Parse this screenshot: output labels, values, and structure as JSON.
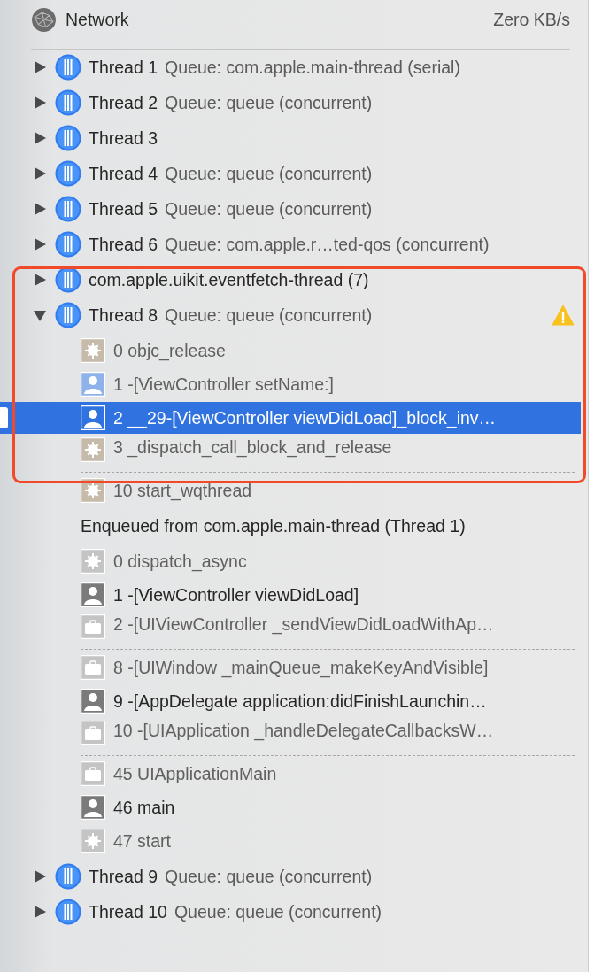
{
  "header": {
    "title": "Network",
    "rate": "Zero KB/s"
  },
  "annotation_box": true,
  "threads": [
    {
      "name": "Thread 1",
      "queue": "Queue: com.apple.main-thread (serial)",
      "expanded": false
    },
    {
      "name": "Thread 2",
      "queue": "Queue: queue (concurrent)",
      "expanded": false
    },
    {
      "name": "Thread 3",
      "expanded": false
    },
    {
      "name": "Thread 4",
      "queue": "Queue: queue (concurrent)",
      "expanded": false
    },
    {
      "name": "Thread 5",
      "queue": "Queue: queue (concurrent)",
      "expanded": false
    },
    {
      "name": "Thread 6",
      "queue": "Queue: com.apple.r…ted-qos (concurrent)",
      "expanded": false
    },
    {
      "name": "com.apple.uikit.eventfetch-thread (7)",
      "expanded": false
    },
    {
      "name": "Thread 8",
      "queue": "Queue: queue (concurrent)",
      "expanded": true,
      "warning": true,
      "frames": [
        {
          "label": "0 objc_release",
          "kind": "system",
          "selected": false,
          "break_after": false
        },
        {
          "label": "1 -[ViewController setName:]",
          "kind": "user",
          "selected": false,
          "break_after": false
        },
        {
          "label": "2 __29-[ViewController viewDidLoad]_block_inv…",
          "kind": "user",
          "selected": true,
          "break_after": false
        },
        {
          "label": "3 _dispatch_call_block_and_release",
          "kind": "system",
          "selected": false,
          "break_after": true
        },
        {
          "label": "10 start_wqthread",
          "kind": "system",
          "selected": false,
          "break_after": false
        }
      ],
      "enqueued": {
        "label": "Enqueued from com.apple.main-thread (Thread 1)",
        "frames": [
          {
            "label": "0 dispatch_async",
            "kind": "system",
            "selected": false,
            "break_after": false
          },
          {
            "label": "1 -[ViewController viewDidLoad]",
            "kind": "user",
            "selected": false,
            "break_after": false
          },
          {
            "label": "2 -[UIViewController _sendViewDidLoadWithAp…",
            "kind": "framework",
            "selected": false,
            "break_after": true
          },
          {
            "label": "8 -[UIWindow _mainQueue_makeKeyAndVisible]",
            "kind": "framework",
            "selected": false,
            "break_after": false
          },
          {
            "label": "9 -[AppDelegate application:didFinishLaunchin…",
            "kind": "user",
            "selected": false,
            "break_after": false
          },
          {
            "label": "10 -[UIApplication _handleDelegateCallbacksW…",
            "kind": "framework",
            "selected": false,
            "break_after": true
          },
          {
            "label": "45 UIApplicationMain",
            "kind": "framework",
            "selected": false,
            "break_after": false
          },
          {
            "label": "46 main",
            "kind": "user",
            "selected": false,
            "break_after": false
          },
          {
            "label": "47 start",
            "kind": "system",
            "selected": false,
            "break_after": false
          }
        ]
      }
    },
    {
      "name": "Thread 9",
      "queue": "Queue: queue (concurrent)",
      "expanded": false
    },
    {
      "name": "Thread 10",
      "queue": "Queue: queue (concurrent)",
      "expanded": false
    }
  ]
}
